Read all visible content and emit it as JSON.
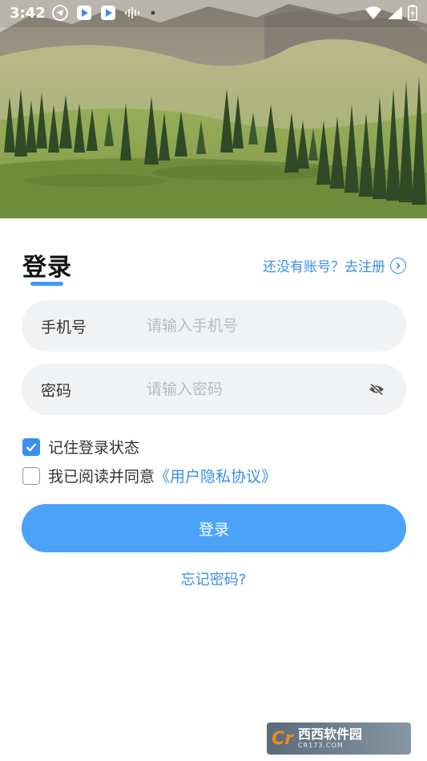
{
  "status_bar": {
    "time": "3:42",
    "left_icons": [
      "telegram-icon",
      "video-app-icon",
      "video-app-icon",
      "audio-wave-icon",
      "dot-icon"
    ],
    "right_icons": [
      "wifi-icon",
      "signal-icon",
      "battery-charging-icon"
    ]
  },
  "hero": {
    "image": "mountain-meadow-landscape"
  },
  "login": {
    "title": "登录",
    "register_link": "还没有账号？去注册",
    "phone_label": "手机号",
    "phone_placeholder": "请输入手机号",
    "password_label": "密码",
    "password_placeholder": "请输入密码",
    "remember_label": "记住登录状态",
    "remember_checked": true,
    "agree_prefix": "我已阅读并同意",
    "policy_link": "《用户隐私协议》",
    "agree_checked": false,
    "submit_label": "登录",
    "forgot_link": "忘记密码?"
  },
  "watermark": {
    "logo": "Cr",
    "name": "西西软件园",
    "url": "CR173.COM"
  },
  "colors": {
    "accent": "#3a8fe6",
    "button": "#4aa3f8",
    "field_bg": "#f1f2f4",
    "placeholder": "#b8bbc0"
  }
}
